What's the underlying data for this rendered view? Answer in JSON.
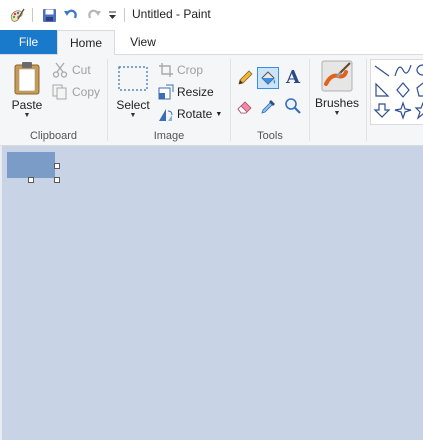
{
  "window": {
    "title": "Untitled - Paint"
  },
  "tabs": {
    "file": "File",
    "home": "Home",
    "view": "View"
  },
  "clipboard": {
    "paste": "Paste",
    "cut": "Cut",
    "copy": "Copy",
    "group_label": "Clipboard"
  },
  "image": {
    "select": "Select",
    "crop": "Crop",
    "resize": "Resize",
    "rotate": "Rotate",
    "group_label": "Image"
  },
  "tools": {
    "group_label": "Tools"
  },
  "brushes": {
    "label": "Brushes"
  },
  "colors": {
    "accent": "#1979ca",
    "canvas_bg": "#c9d3e6",
    "selection_fill": "#7c9cc8"
  }
}
